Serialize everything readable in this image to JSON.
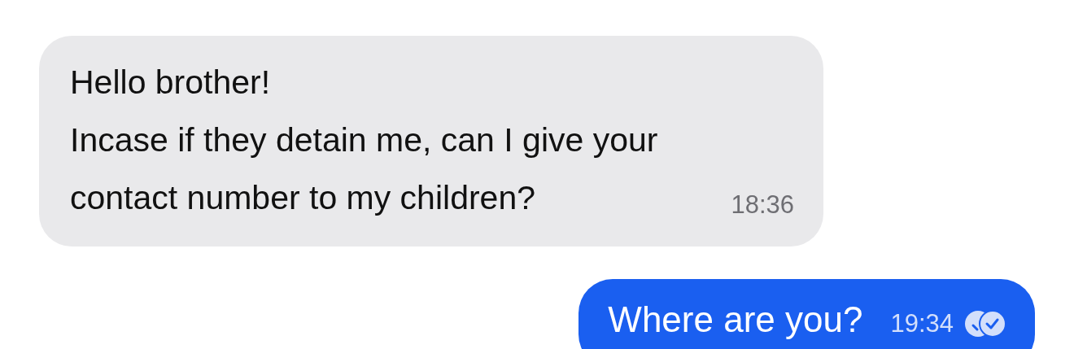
{
  "messages": [
    {
      "kind": "incoming",
      "lines": [
        "Hello brother!",
        "Incase if they detain me, can I give your",
        "contact number to my children?"
      ],
      "time": "18:36"
    },
    {
      "kind": "outgoing",
      "lines": [
        "Where are you?"
      ],
      "time": "19:34",
      "read": true
    }
  ]
}
